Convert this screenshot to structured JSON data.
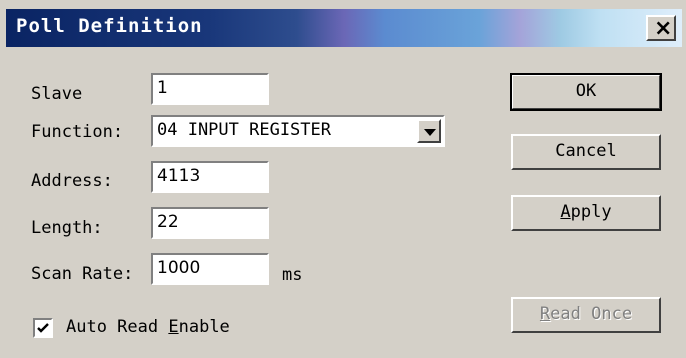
{
  "window": {
    "title": "Poll Definition",
    "close_glyph": "×"
  },
  "fields": {
    "slave": {
      "label": "Slave",
      "value": "1"
    },
    "function": {
      "label": "Function:",
      "value": "04 INPUT REGISTER"
    },
    "address": {
      "label": "Address:",
      "value": "4113"
    },
    "length": {
      "label": "Length:",
      "value": "22"
    },
    "scan_rate": {
      "label": "Scan Rate:",
      "value": "1000",
      "unit": "ms"
    }
  },
  "auto_read": {
    "checked": true,
    "label_pre": "Auto Read ",
    "label_accel": "E",
    "label_post": "nable"
  },
  "buttons": {
    "ok": "OK",
    "cancel": "Cancel",
    "apply_accel": "A",
    "apply_rest": "pply",
    "read_once_accel": "R",
    "read_once_rest": "ead Once"
  },
  "icons": {
    "close": "close-icon",
    "dropdown": "chevron-down-icon",
    "check": "checkmark-icon"
  }
}
